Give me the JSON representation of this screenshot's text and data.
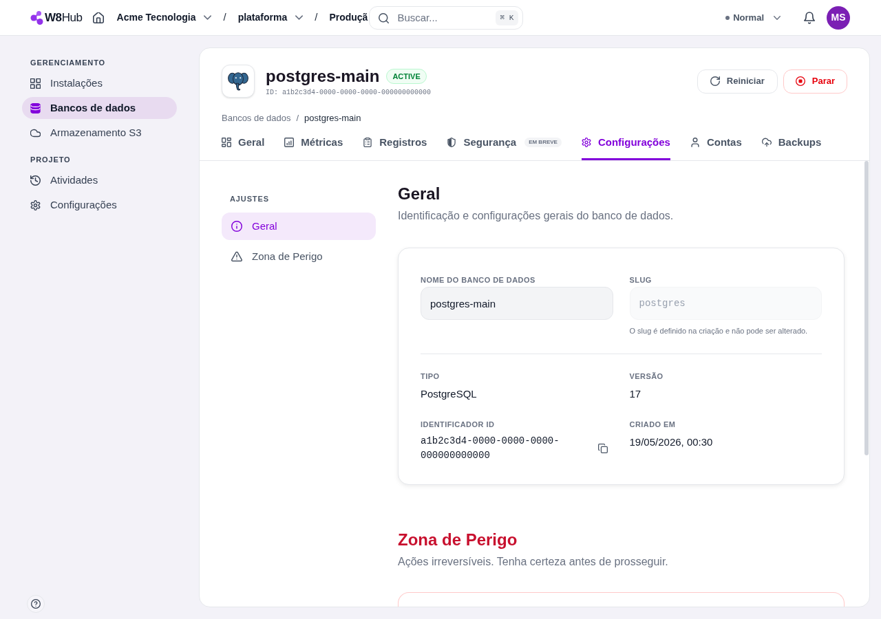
{
  "topbar": {
    "logo": "**W8**Hub",
    "breadcrumbs": {
      "separator": "/",
      "items": [
        {
          "label": "Acme Tecnologia",
          "dropdown": true
        },
        {
          "label": "plataforma",
          "dropdown": true
        },
        {
          "label": "Produçã",
          "dropdown": false
        }
      ]
    },
    "search": {
      "placeholder": "Buscar...",
      "shortcut": "⌘ K"
    },
    "mode": {
      "label": "Normal"
    },
    "avatar": "MS"
  },
  "sidebar": {
    "sections": [
      {
        "title": "GERENCIAMENTO",
        "items": [
          {
            "label": "Instalações",
            "selected": false
          },
          {
            "label": "Bancos de dados",
            "selected": true
          },
          {
            "label": "Armazenamento S3",
            "selected": false
          }
        ]
      },
      {
        "title": "PROJETO",
        "items": [
          {
            "label": "Atividades",
            "selected": false
          },
          {
            "label": "Configurações",
            "selected": false
          }
        ]
      }
    ]
  },
  "header": {
    "title": "postgres-main",
    "status": "ACTIVE",
    "id": "ID: a1b2c3d4-0000-0000-0000-000000000000",
    "actions": [
      {
        "label": "Reiniciar",
        "kind": "default"
      },
      {
        "label": "Parar",
        "kind": "danger"
      }
    ],
    "breadcrumb": {
      "separator": "/",
      "items": [
        "Bancos de dados",
        "postgres-main"
      ]
    }
  },
  "tabs": [
    {
      "label": "Geral",
      "selected": false
    },
    {
      "label": "Métricas",
      "selected": false
    },
    {
      "label": "Registros",
      "selected": false
    },
    {
      "label": "Segurança",
      "selected": false,
      "badge": "EM BREVE"
    },
    {
      "label": "Configurações",
      "selected": true
    },
    {
      "label": "Contas",
      "selected": false
    },
    {
      "label": "Backups",
      "selected": false
    }
  ],
  "settings_nav": {
    "title": "AJUSTES",
    "items": [
      {
        "label": "Geral",
        "selected": true
      },
      {
        "label": "Zona de Perigo",
        "selected": false
      }
    ]
  },
  "general": {
    "title": "Geral",
    "description": "Identificação e configurações gerais do banco de dados.",
    "fields": [
      {
        "label": "NOME DO BANCO DE DADOS",
        "value": "postgres-main",
        "kind": "text",
        "disabled": false
      },
      {
        "label": "SLUG",
        "value": "postgres",
        "kind": "code",
        "disabled": true,
        "hint": "O slug é definido na criação e não pode ser alterado."
      }
    ],
    "details": [
      {
        "label": "TIPO",
        "value": "PostgreSQL",
        "kind": "text"
      },
      {
        "label": "VERSÃO",
        "value": "17",
        "kind": "text"
      },
      {
        "label": "IDENTIFICADOR ID",
        "value": "a1b2c3d4-0000-0000-0000-000000000000",
        "kind": "copyable"
      },
      {
        "label": "CRIADO EM",
        "value": "19/05/2026, 00:30",
        "kind": "text"
      }
    ]
  },
  "danger_zone": {
    "title": "Zona de Perigo",
    "description": "Ações irreversíveis. Tenha certeza antes de prosseguir."
  }
}
